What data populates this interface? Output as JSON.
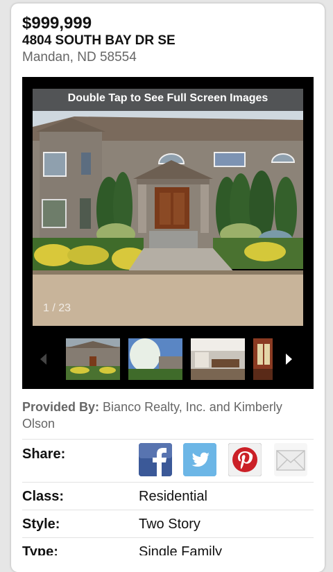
{
  "listing": {
    "price": "$999,999",
    "street": "4804 SOUTH BAY DR SE",
    "city": "Mandan, ND 58554"
  },
  "gallery": {
    "overlay_text": "Double Tap to See Full Screen Images",
    "counter": "1 / 23",
    "thumbnails": [
      "house-front-thumb",
      "house-trees-thumb",
      "kitchen-thumb",
      "interior-thumb"
    ]
  },
  "provided": {
    "label": "Provided By:",
    "value": "Bianco Realty, Inc. and Kimberly Olson"
  },
  "share": {
    "label": "Share:",
    "buttons": [
      "facebook-icon",
      "twitter-icon",
      "pinterest-icon",
      "email-icon"
    ],
    "colors": {
      "facebook": "#3b5998",
      "twitter": "#55acee",
      "pinterest": "#cb2027",
      "email": "#e8e8e8"
    }
  },
  "details": [
    {
      "label": "Class:",
      "value": "Residential"
    },
    {
      "label": "Style:",
      "value": "Two Story"
    },
    {
      "label": "Type:",
      "value": "Single Family"
    }
  ]
}
